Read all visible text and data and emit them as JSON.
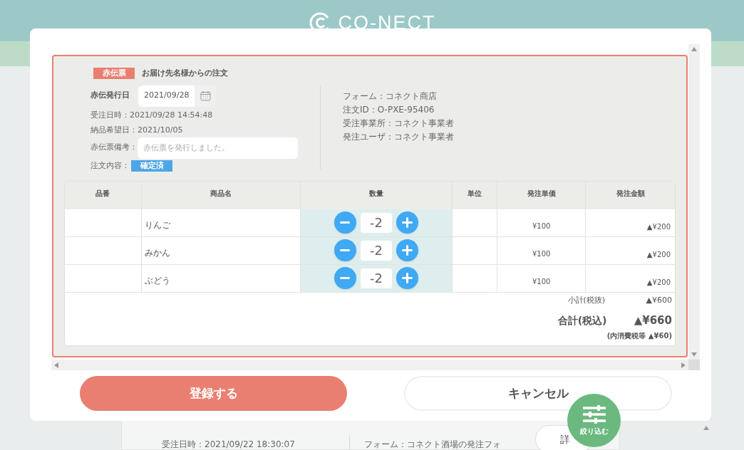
{
  "header": {
    "logo": "CO-NECT"
  },
  "background_order": {
    "received": "受注日時：2021/09/22 18:30:07",
    "form": "フォーム：コネクト酒場の発注フォ",
    "detail_button": "詳"
  },
  "modal": {
    "badge": "赤伝票",
    "title": "お届け先名様からの注文",
    "issue_date": {
      "label": "赤伝発行日",
      "value": "2021/09/28"
    },
    "info_left": [
      "受注日時：2021/09/28 14:54:48",
      "納品希望日：2021/10/05"
    ],
    "memo": {
      "label": "赤伝票備考：",
      "placeholder": "赤伝票を発行しました。"
    },
    "status": {
      "label": "注文内容：",
      "badge": "確定済"
    },
    "info_right": [
      "フォーム：コネクト商店",
      "注文ID：O-PXE-95406",
      "受注事業所：コネクト事業者",
      "発注ユーザ：コネクト事業者"
    ],
    "table": {
      "columns": [
        "品番",
        "商品名",
        "数量",
        "単位",
        "発注単価",
        "発注金額"
      ],
      "rows": [
        {
          "name": "りんご",
          "quantity": "-2",
          "price": "¥100",
          "amount": "▲¥200"
        },
        {
          "name": "みかん",
          "quantity": "-2",
          "price": "¥100",
          "amount": "▲¥200"
        },
        {
          "name": "ぶどう",
          "quantity": "-2",
          "price": "¥100",
          "amount": "▲¥200"
        }
      ]
    },
    "subtotal": {
      "label": "小計(税抜)",
      "value": "▲¥600"
    },
    "total": {
      "label": "合計(税込)",
      "value": "▲¥660"
    },
    "tax_note": "(内消費税等 ▲¥60)"
  },
  "buttons": {
    "register": "登録する",
    "cancel": "キャンセル"
  },
  "filter_button": {
    "label": "絞り込む"
  }
}
